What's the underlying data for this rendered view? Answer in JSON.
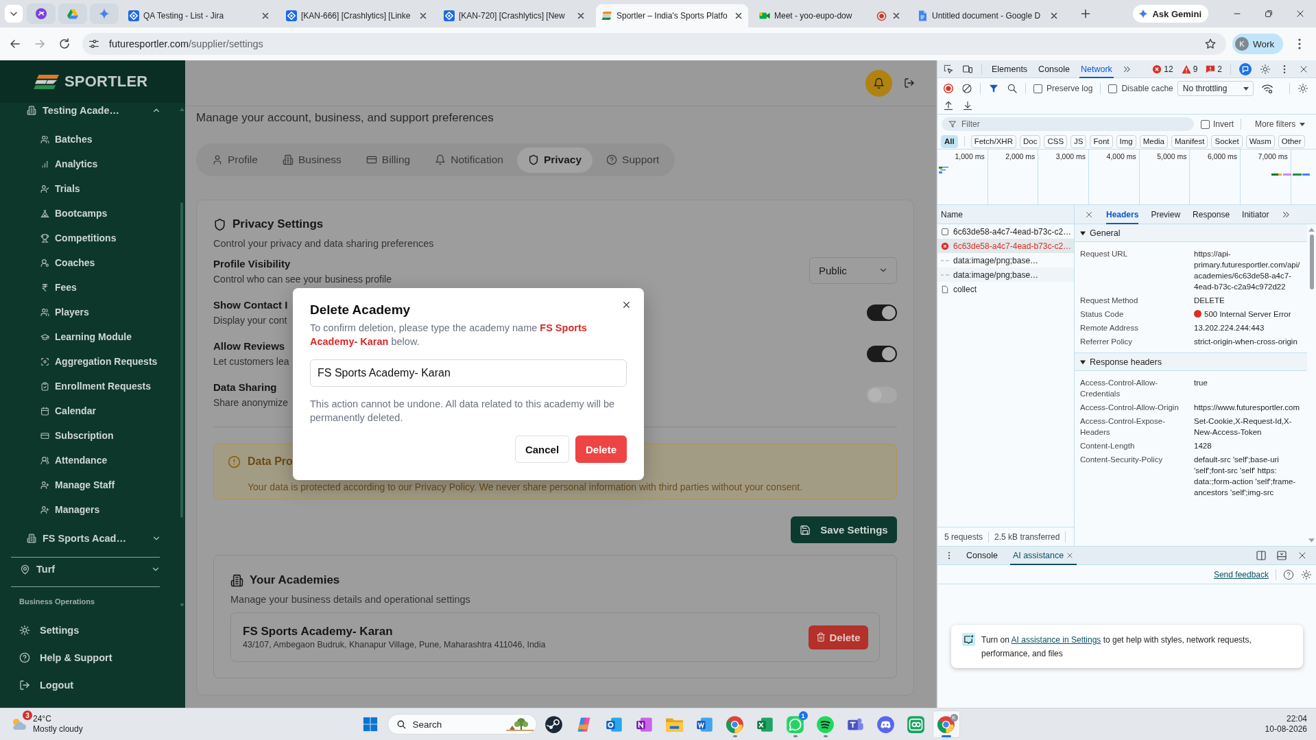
{
  "browser": {
    "tabs": [
      {
        "title": "QA Testing - List - Jira",
        "selected": false,
        "recording": false
      },
      {
        "title": "[KAN-666] [Crashlytics] [Linke",
        "selected": false,
        "recording": false
      },
      {
        "title": "[KAN-720] [Crashlytics] [New",
        "selected": false,
        "recording": false
      },
      {
        "title": "Sportler – India's Sports Platfo",
        "selected": true,
        "recording": false
      },
      {
        "title": "Meet - yoo-eupo-dow",
        "selected": false,
        "recording": true
      },
      {
        "title": "Untitled document - Google D",
        "selected": false,
        "recording": false
      }
    ],
    "ask_gemini": "Ask Gemini",
    "address": {
      "host": "futuresportler.com",
      "path": "/supplier/settings"
    },
    "profile": {
      "initial": "K",
      "label": "Work"
    }
  },
  "sidebar": {
    "logo": "SPORTLER",
    "groups": [
      {
        "label": "Testing Acade…",
        "expanded": true,
        "children": [
          {
            "label": "Batches"
          },
          {
            "label": "Analytics"
          },
          {
            "label": "Trials"
          },
          {
            "label": "Bootcamps"
          },
          {
            "label": "Competitions"
          },
          {
            "label": "Coaches"
          },
          {
            "label": "Fees"
          },
          {
            "label": "Players"
          },
          {
            "label": "Learning Module"
          },
          {
            "label": "Aggregation Requests"
          },
          {
            "label": "Enrollment Requests"
          },
          {
            "label": "Calendar"
          },
          {
            "label": "Subscription"
          },
          {
            "label": "Attendance"
          },
          {
            "label": "Manage Staff"
          },
          {
            "label": "Managers"
          }
        ]
      },
      {
        "label": "FS Sports Acad…",
        "expanded": false
      }
    ],
    "turf": {
      "label": "Turf",
      "expanded": false
    },
    "section_heading": "Business Operations",
    "footer": [
      {
        "label": "Settings"
      },
      {
        "label": "Help & Support"
      },
      {
        "label": "Logout"
      }
    ]
  },
  "settings_page": {
    "subtitle": "Manage your account, business, and support preferences",
    "tabs": [
      {
        "label": "Profile",
        "selected": false
      },
      {
        "label": "Business",
        "selected": false
      },
      {
        "label": "Billing",
        "selected": false
      },
      {
        "label": "Notification",
        "selected": false
      },
      {
        "label": "Privacy",
        "selected": true
      },
      {
        "label": "Support",
        "selected": false
      }
    ],
    "privacy": {
      "title": "Privacy Settings",
      "subtitle": "Control your privacy and data sharing preferences",
      "settings": [
        {
          "kind": "select",
          "title": "Profile Visibility",
          "description": "Control who can see your business profile",
          "value": "Public"
        },
        {
          "kind": "toggle",
          "title": "Show Contact I",
          "description": "Display your cont",
          "on": true
        },
        {
          "kind": "toggle",
          "title": "Allow Reviews",
          "description": "Let customers lea",
          "on": true
        },
        {
          "kind": "toggle",
          "title": "Data Sharing",
          "description": "Share anonymize",
          "on": false
        }
      ],
      "notice": {
        "title": "Data Pro",
        "text": "Your data is protected according to our Privacy Policy. We never share personal information with third parties without your consent."
      },
      "save_button": "Save Settings"
    },
    "academies": {
      "title": "Your Academies",
      "subtitle": "Manage your business details and operational settings",
      "items": [
        {
          "name": "FS Sports Academy- Karan",
          "address": "43/107, Ambegaon Budruk, Khanapur Village, Pune, Maharashtra 411046, India",
          "action": "Delete"
        }
      ]
    }
  },
  "dialog": {
    "title": "Delete Academy",
    "prompt": "To confirm deletion, please type the academy name **FS Sports Academy- Karan** below.",
    "value": "FS Sports Academy- Karan",
    "warning": "This action cannot be undone. All data related to this academy will be permanently deleted.",
    "buttons": [
      {
        "label": "Cancel",
        "kind": "secondary"
      },
      {
        "label": "Delete",
        "kind": "danger"
      }
    ]
  },
  "devtools": {
    "panel_tabs": [
      {
        "label": "Elements",
        "selected": false
      },
      {
        "label": "Console",
        "selected": false
      },
      {
        "label": "Network",
        "selected": true
      }
    ],
    "counts": [
      {
        "kind": "error",
        "value": "12"
      },
      {
        "kind": "warning",
        "value": "9"
      },
      {
        "kind": "issue",
        "value": "2"
      }
    ],
    "preserve_log": {
      "label": "Preserve log",
      "checked": false
    },
    "disable_cache": {
      "label": "Disable cache",
      "checked": false
    },
    "throttling": "No throttling",
    "filter": {
      "placeholder": "Filter"
    },
    "invert": {
      "label": "Invert",
      "checked": false
    },
    "more_filters": "More filters",
    "type_filters": [
      {
        "label": "All",
        "selected": true
      },
      {
        "label": "Fetch/XHR",
        "selected": false
      },
      {
        "label": "Doc",
        "selected": false
      },
      {
        "label": "CSS",
        "selected": false
      },
      {
        "label": "JS",
        "selected": false
      },
      {
        "label": "Font",
        "selected": false
      },
      {
        "label": "Img",
        "selected": false
      },
      {
        "label": "Media",
        "selected": false
      },
      {
        "label": "Manifest",
        "selected": false
      },
      {
        "label": "Socket",
        "selected": false
      },
      {
        "label": "Wasm",
        "selected": false
      },
      {
        "label": "Other",
        "selected": false
      }
    ],
    "timeline_ticks": [
      "1,000 ms",
      "2,000 ms",
      "3,000 ms",
      "4,000 ms",
      "5,000 ms",
      "6,000 ms",
      "7,000 ms"
    ],
    "name_header": "Name",
    "requests": [
      {
        "name": "6c63de58-a4c7-4ead-b73c-c2…",
        "kind": "fetch",
        "failed": false,
        "selected": false
      },
      {
        "name": "6c63de58-a4c7-4ead-b73c-c2…",
        "kind": "fetch",
        "failed": true,
        "selected": true
      },
      {
        "name": "data:image/png;base…",
        "kind": "image",
        "failed": false,
        "selected": false
      },
      {
        "name": "data:image/png;base…",
        "kind": "image",
        "failed": false,
        "selected": false
      },
      {
        "name": "collect",
        "kind": "document",
        "failed": false,
        "selected": false
      }
    ],
    "summary": [
      "5 requests",
      "2.5 kB transferred"
    ],
    "detail_tabs": [
      {
        "label": "Headers",
        "selected": true
      },
      {
        "label": "Preview",
        "selected": false
      },
      {
        "label": "Response",
        "selected": false
      },
      {
        "label": "Initiator",
        "selected": false
      }
    ],
    "sections": [
      {
        "title": "General",
        "expanded": true,
        "rows": [
          {
            "kind": "text",
            "name": "Request URL",
            "value": "https://api-primary.futuresportler.com/api/academies/6c63de58-a4c7-4ead-b73c-c2a94c972d22"
          },
          {
            "kind": "text",
            "name": "Request Method",
            "value": "DELETE"
          },
          {
            "kind": "status",
            "name": "Status Code",
            "value": "500 Internal Server Error"
          },
          {
            "kind": "text",
            "name": "Remote Address",
            "value": "13.202.224.244:443"
          },
          {
            "kind": "text",
            "name": "Referrer Policy",
            "value": "strict-origin-when-cross-origin"
          }
        ]
      },
      {
        "title": "Response headers",
        "expanded": true,
        "rows": [
          {
            "kind": "text",
            "name": "Access-Control-Allow-Credentials",
            "value": "true"
          },
          {
            "kind": "text",
            "name": "Access-Control-Allow-Origin",
            "value": "https://www.futuresportler.com"
          },
          {
            "kind": "text",
            "name": "Access-Control-Expose-Headers",
            "value": "Set-Cookie,X-Request-Id,X-New-Access-Token"
          },
          {
            "kind": "text",
            "name": "Content-Length",
            "value": "1428"
          },
          {
            "kind": "text",
            "name": "Content-Security-Policy",
            "value": "default-src 'self';base-uri 'self';font-src 'self' https: data:;form-action 'self';frame-ancestors 'self';img-src"
          }
        ]
      }
    ],
    "drawer_tabs": [
      {
        "label": "Console",
        "selected": false,
        "closable": false
      },
      {
        "label": "AI assistance",
        "selected": true,
        "closable": true
      }
    ],
    "send_feedback": "Send feedback",
    "ai_notice": {
      "before": "Turn on",
      "link": "AI assistance in Settings",
      "after": "to get help with styles, network requests, performance, and files"
    }
  },
  "taskbar": {
    "weather": {
      "badge": "3",
      "temperature": "24°C",
      "condition": "Mostly cloudy"
    },
    "search": {
      "placeholder": "Search"
    },
    "apps": [
      {
        "running": false,
        "active": false
      },
      {
        "running": false,
        "active": false
      },
      {
        "running": false,
        "active": false
      },
      {
        "running": false,
        "active": false
      },
      {
        "running": false,
        "active": false
      },
      {
        "running": false,
        "active": false
      },
      {
        "running": true,
        "active": false
      },
      {
        "running": false,
        "active": false
      },
      {
        "running": true,
        "active": false,
        "badge": "1"
      },
      {
        "running": true,
        "active": false
      },
      {
        "running": false,
        "active": false
      },
      {
        "running": false,
        "active": false
      },
      {
        "running": false,
        "active": false
      },
      {
        "running": true,
        "active": true,
        "avatar": "K"
      }
    ],
    "clock": {
      "time": "22:04",
      "date": "10-08-2026"
    }
  }
}
